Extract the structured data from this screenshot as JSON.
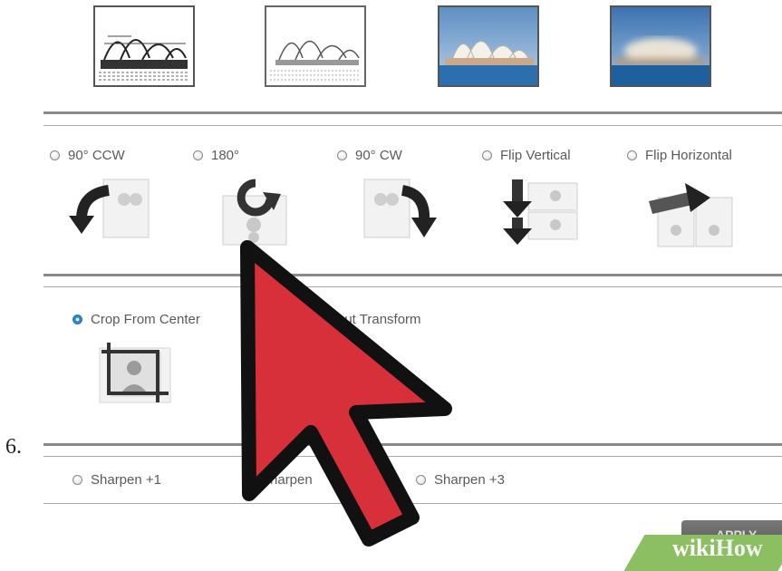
{
  "thumbnails": [
    {
      "name": "Sketch"
    },
    {
      "name": "Pencil"
    },
    {
      "name": "Original"
    },
    {
      "name": "Blur"
    }
  ],
  "rotate": {
    "options": [
      {
        "label": "90° CCW",
        "icon": "rotate-ccw-icon"
      },
      {
        "label": "180°",
        "icon": "rotate-180-icon"
      },
      {
        "label": "90° CW",
        "icon": "rotate-cw-icon"
      },
      {
        "label": "Flip Vertical",
        "icon": "flip-vertical-icon"
      },
      {
        "label": "Flip Horizontal",
        "icon": "flip-horizontal-icon"
      }
    ]
  },
  "crop": {
    "options": [
      {
        "label": "Crop From Center",
        "selected": true
      },
      {
        "label": "out Transform",
        "selected": false
      }
    ]
  },
  "sharpen": {
    "options": [
      {
        "label": "Sharpen +1"
      },
      {
        "label": "Sharpen"
      },
      {
        "label": "Sharpen +3"
      }
    ]
  },
  "step_number": "6.",
  "apply_label": "APPLY",
  "watermark": {
    "wiki": "wiki",
    "how": "How"
  },
  "colors": {
    "cursor": "#d7303b",
    "accent": "#2a7fc0",
    "watermark": "#8bbf62"
  }
}
